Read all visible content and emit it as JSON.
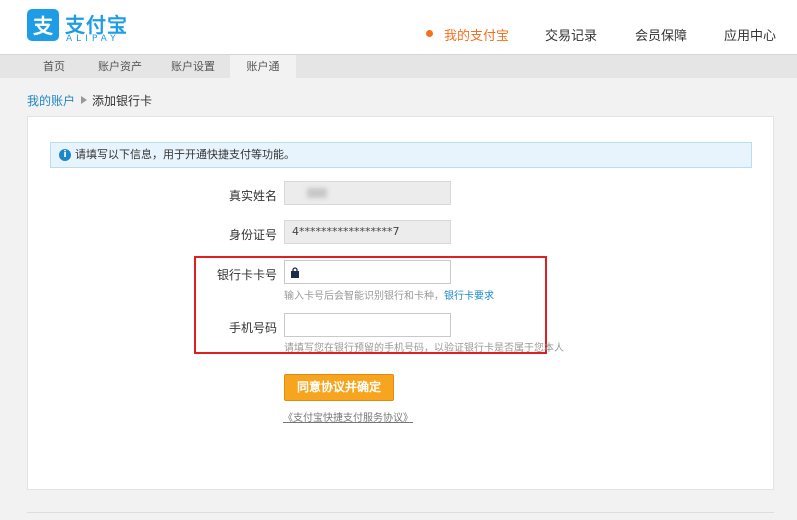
{
  "brand": {
    "name_cn": "支付宝",
    "name_en": "ALIPAY",
    "color": "#1e9de6"
  },
  "main_nav": [
    {
      "label": "我的支付宝",
      "active": true
    },
    {
      "label": "交易记录",
      "active": false
    },
    {
      "label": "会员保障",
      "active": false
    },
    {
      "label": "应用中心",
      "active": false
    }
  ],
  "sub_nav": [
    {
      "label": "首页",
      "active": false
    },
    {
      "label": "账户资产",
      "active": false
    },
    {
      "label": "账户设置",
      "active": false
    },
    {
      "label": "账户通",
      "active": true
    }
  ],
  "breadcrumb": {
    "parent": "我的账户",
    "current": "添加银行卡"
  },
  "notice": {
    "text": "请填写以下信息，用于开通快捷支付等功能。"
  },
  "form": {
    "real_name": {
      "label": "真实姓名",
      "value": ""
    },
    "id_number": {
      "label": "身份证号",
      "value": "4*****************7"
    },
    "card_number": {
      "label": "银行卡卡号",
      "value": "",
      "hint": "输入卡号后会智能识别银行和卡种，",
      "hint_link": "银行卡要求"
    },
    "phone": {
      "label": "手机号码",
      "value": "",
      "hint": "请填写您在银行预留的手机号码，以验证银行卡是否属于您本人"
    }
  },
  "submit_label": "同意协议并确定",
  "agreement_link": "《支付宝快捷支付服务协议》",
  "colors": {
    "accent": "#f4711e",
    "button": "#f7a41e",
    "link": "#1e88c7",
    "highlight": "#e02020"
  }
}
